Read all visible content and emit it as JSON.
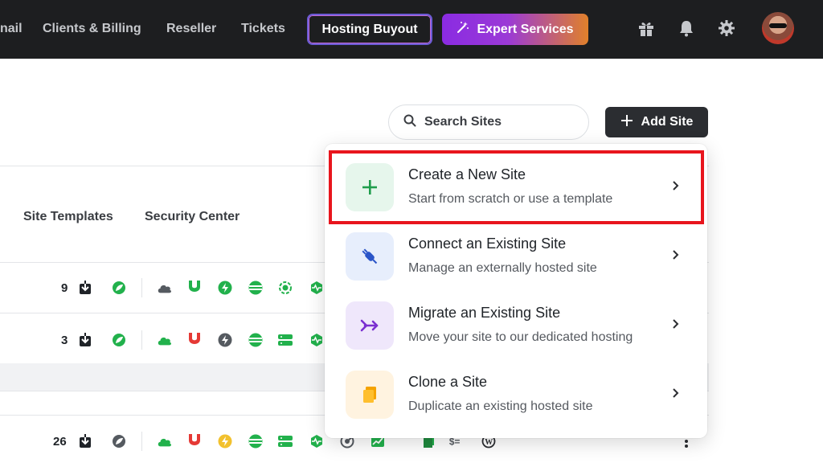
{
  "nav": {
    "links": [
      "nail",
      "Clients & Billing",
      "Reseller",
      "Tickets"
    ],
    "buyout_label": "Hosting Buyout",
    "expert_label": "Expert Services",
    "icons": [
      "gift-icon",
      "bell-icon",
      "gear-icon"
    ]
  },
  "toolbar": {
    "search_placeholder": "Search Sites",
    "add_label": "Add Site"
  },
  "columns": {
    "templates": "Site Templates",
    "security": "Security Center"
  },
  "rows": [
    {
      "count": "9"
    },
    {
      "count": "3"
    },
    {
      "count": "26"
    }
  ],
  "menu": {
    "items": [
      {
        "title": "Create a New Site",
        "subtitle": "Start from scratch or use a template",
        "icon": "plus-icon",
        "icon_bg": "#e6f6ec",
        "icon_color": "#1f9d4c"
      },
      {
        "title": "Connect an Existing Site",
        "subtitle": "Manage an externally hosted site",
        "icon": "plug-icon",
        "icon_bg": "#e7eefc",
        "icon_color": "#2b55c8"
      },
      {
        "title": "Migrate an Existing Site",
        "subtitle": "Move your site to our dedicated hosting",
        "icon": "migrate-icon",
        "icon_bg": "#efe7fb",
        "icon_color": "#7a2fd0"
      },
      {
        "title": "Clone a Site",
        "subtitle": "Duplicate an existing hosted site",
        "icon": "copy-icon",
        "icon_bg": "#fff3e0",
        "icon_color": "#f5a300"
      }
    ]
  },
  "colors": {
    "green": "#22b14c",
    "red": "#e53935",
    "yellow": "#f2c12e",
    "highlight": "#e8151d"
  }
}
